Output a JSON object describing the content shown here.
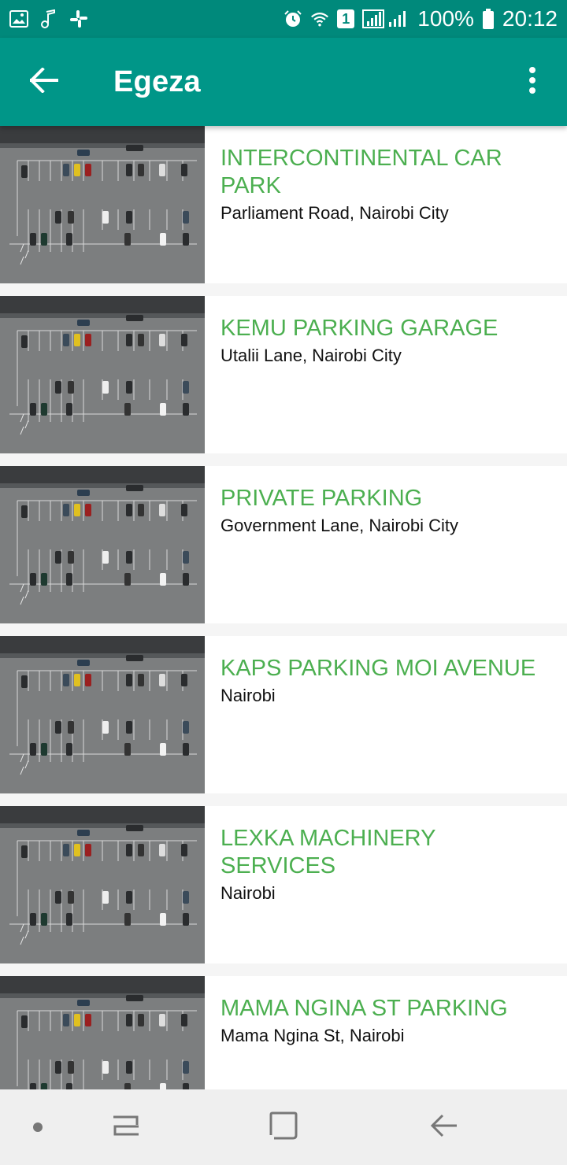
{
  "status_bar": {
    "battery": "100%",
    "time": "20:12",
    "notif_badge": "1",
    "left_icons": [
      "image-icon",
      "music-note-icon",
      "slack-icon"
    ],
    "right_icons": [
      "alarm-icon",
      "wifi-icon",
      "sim-badge-icon",
      "signal-icon",
      "battery-icon"
    ]
  },
  "app_bar": {
    "title": "Egeza",
    "back_icon": "arrow-back-icon",
    "menu_icon": "more-vert-icon"
  },
  "colors": {
    "app_bar": "#009688",
    "status_bar": "#00897b",
    "title_green": "#4caf50"
  },
  "parkings": [
    {
      "name": "INTERCONTINENTAL CAR PARK",
      "address": "Parliament Road, Nairobi City"
    },
    {
      "name": "KEMU PARKING GARAGE",
      "address": "Utalii Lane, Nairobi City"
    },
    {
      "name": "PRIVATE PARKING",
      "address": "Government Lane, Nairobi City"
    },
    {
      "name": "KAPS PARKING MOI AVENUE",
      "address": "Nairobi"
    },
    {
      "name": "LEXKA MACHINERY SERVICES",
      "address": "Nairobi"
    },
    {
      "name": "MAMA NGINA ST PARKING",
      "address": "Mama Ngina St, Nairobi"
    }
  ],
  "nav_bar": {
    "icons": [
      "dot-icon",
      "recents-icon",
      "home-icon",
      "back-icon"
    ]
  }
}
